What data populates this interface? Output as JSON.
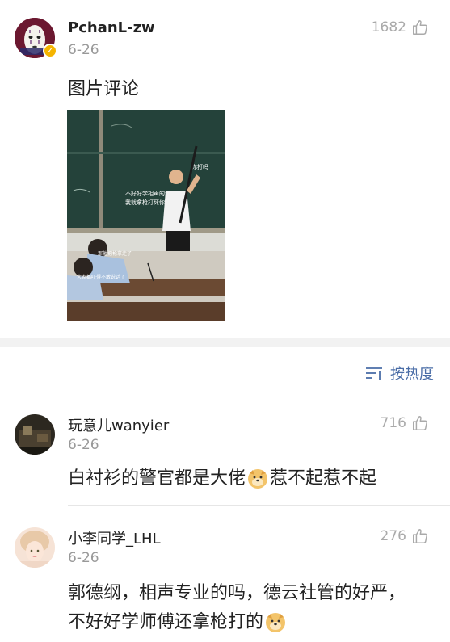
{
  "main_comment": {
    "username": "PchanL-zw",
    "date": "6-26",
    "likes": "1682",
    "text": "图片评论",
    "image_captions": {
      "board": "不好好学相声的话\n我就拿枪打死你",
      "speech": "你打吗",
      "student1": "那他把枪拿走了",
      "student2": "大家都吓得不敢说话了"
    }
  },
  "sort": {
    "label": "按热度"
  },
  "replies": [
    {
      "username": "玩意儿wanyier",
      "date": "6-26",
      "likes": "716",
      "text_before": "白衬衫的警官都是大佬",
      "text_after": "惹不起惹不起"
    },
    {
      "username": "小李同学_LHL",
      "date": "6-26",
      "likes": "276",
      "text_before": "郭德纲，相声专业的吗，德云社管的好严，不好好学师傅还拿枪打的",
      "text_after": ""
    }
  ],
  "colors": {
    "link_blue": "#4a6da7",
    "verified_gold": "#f5b400",
    "muted_gray": "#999999"
  }
}
